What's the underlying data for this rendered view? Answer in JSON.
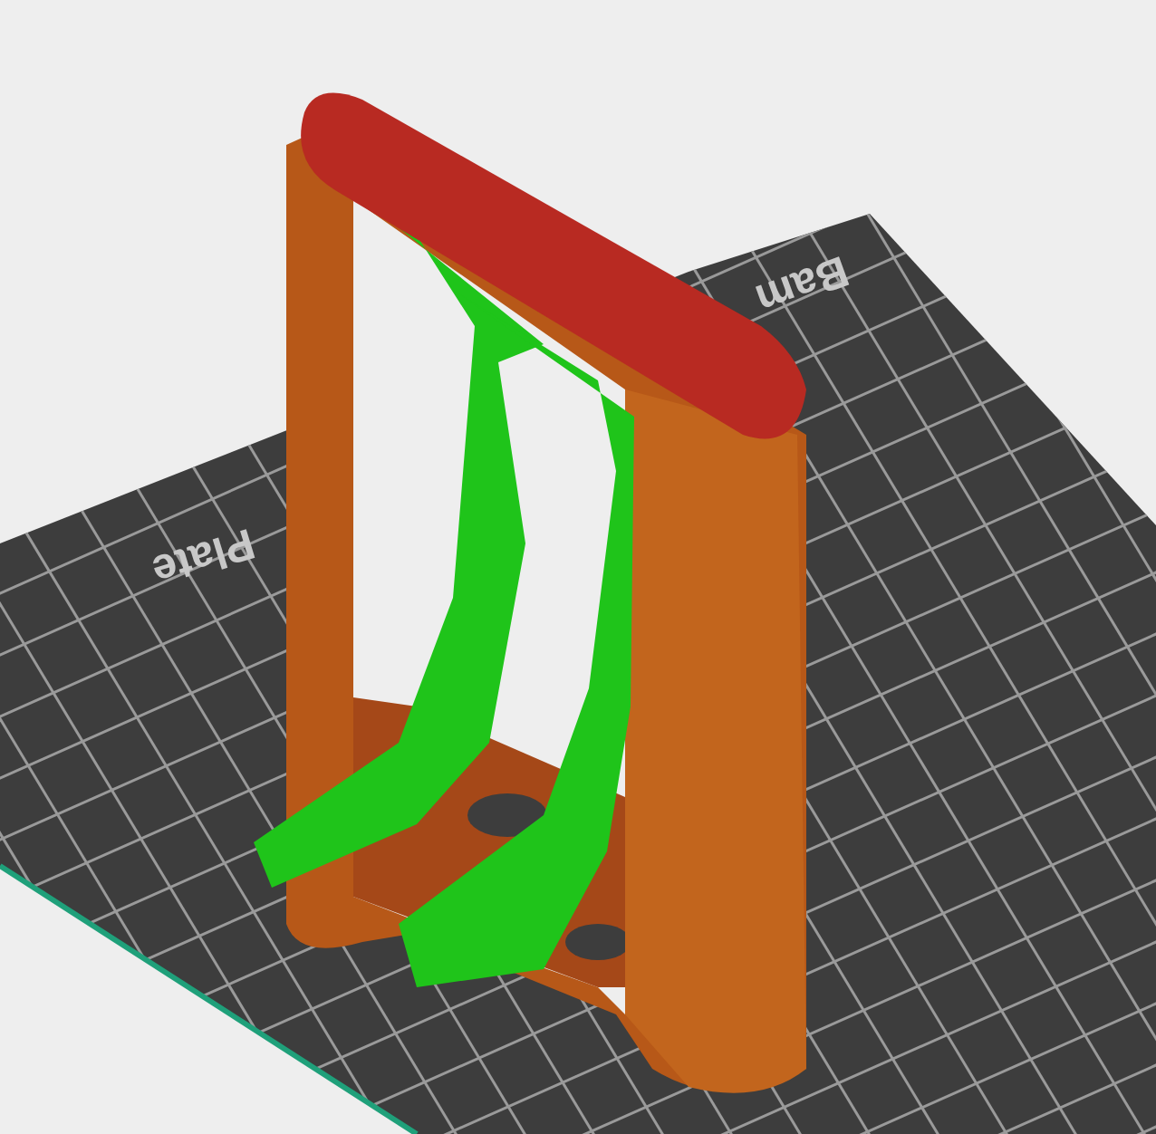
{
  "viewport": {
    "plate_labels": [
      {
        "text": "Bam"
      },
      {
        "text": "Plate"
      }
    ]
  }
}
